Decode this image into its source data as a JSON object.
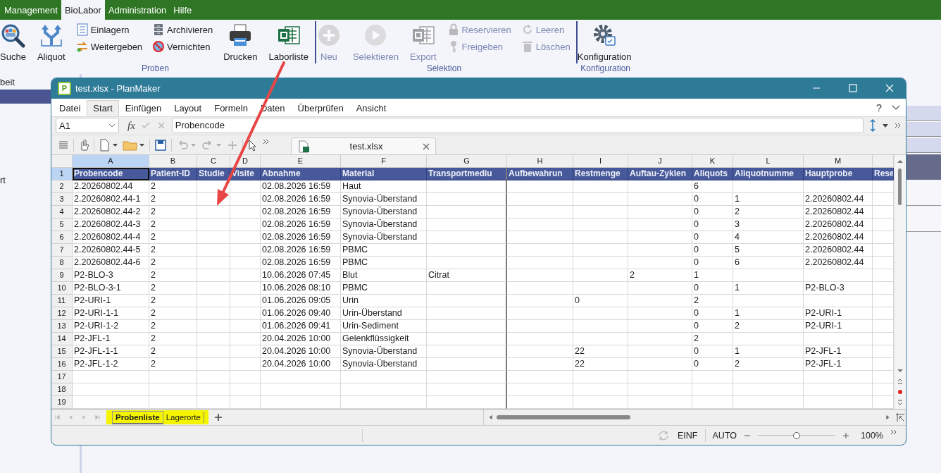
{
  "menu": [
    {
      "label": "Management",
      "selected": false
    },
    {
      "label": "BioLabor",
      "selected": true
    },
    {
      "label": "Administration",
      "selected": false
    },
    {
      "label": "Hilfe",
      "selected": false
    }
  ],
  "ribbon": {
    "groups": [
      {
        "label": "Proben",
        "items": [
          {
            "kind": "large",
            "label": "Suche",
            "disabled": false
          },
          {
            "kind": "large",
            "label": "Aliquot",
            "disabled": false
          },
          {
            "kind": "stack",
            "items": [
              {
                "label": "Einlagern",
                "disabled": false
              },
              {
                "label": "Weitergeben",
                "disabled": false
              }
            ]
          },
          {
            "kind": "stack",
            "items": [
              {
                "label": "Archivieren",
                "disabled": false
              },
              {
                "label": "Vernichten",
                "disabled": false
              }
            ]
          },
          {
            "kind": "large",
            "label": "Drucken",
            "disabled": false
          },
          {
            "kind": "large",
            "label": "Laborliste",
            "disabled": false
          }
        ]
      },
      {
        "label": "Selektion",
        "items": [
          {
            "kind": "large",
            "label": "Neu",
            "disabled": true
          },
          {
            "kind": "large",
            "label": "Selektieren",
            "disabled": true
          },
          {
            "kind": "large",
            "label": "Export",
            "disabled": true
          },
          {
            "kind": "stack",
            "items": [
              {
                "label": "Reservieren",
                "disabled": true
              },
              {
                "label": "Freigeben",
                "disabled": true
              }
            ]
          },
          {
            "kind": "stack",
            "items": [
              {
                "label": "Leeren",
                "disabled": true
              },
              {
                "label": "Löschen",
                "disabled": true
              }
            ]
          }
        ]
      },
      {
        "label": "Konfiguration",
        "items": [
          {
            "kind": "large",
            "label": "Konfiguration",
            "disabled": false
          }
        ]
      }
    ]
  },
  "sidebar": {
    "items": [
      {
        "label": "beit",
        "selected": false
      },
      {
        "selected": true
      },
      {
        "label": "rt",
        "selected": false
      }
    ]
  },
  "window": {
    "app_icon": "P",
    "title": "test.xlsx - PlanMaker",
    "menu": [
      {
        "label": "Datei",
        "selected": false
      },
      {
        "label": "Start",
        "selected": true
      },
      {
        "label": "Einfügen",
        "selected": false
      },
      {
        "label": "Layout",
        "selected": false
      },
      {
        "label": "Formeln",
        "selected": false
      },
      {
        "label": "Daten",
        "selected": false
      },
      {
        "label": "Überprüfen",
        "selected": false
      },
      {
        "label": "Ansicht",
        "selected": false
      }
    ],
    "help": "?",
    "cell_reference": "A1",
    "function_label": "fx",
    "formula": "Probencode",
    "document_tab": "test.xlsx"
  },
  "sheet": {
    "columns": [
      {
        "letter": "A",
        "selected": true
      },
      {
        "letter": "B",
        "selected": false
      },
      {
        "letter": "C",
        "selected": false
      },
      {
        "letter": "D",
        "selected": false
      },
      {
        "letter": "E",
        "selected": false
      },
      {
        "letter": "F",
        "selected": false
      },
      {
        "letter": "G",
        "selected": false
      },
      {
        "letter": "H",
        "selected": false
      },
      {
        "letter": "I",
        "selected": false
      },
      {
        "letter": "J",
        "selected": false
      },
      {
        "letter": "K",
        "selected": false
      },
      {
        "letter": "L",
        "selected": false
      },
      {
        "letter": "M",
        "selected": false
      }
    ],
    "rows": [
      {
        "number": "1",
        "selected": true,
        "kind": "header",
        "cells": [
          "Probencode",
          "Patient-ID",
          "Studie",
          "Visite",
          "Abnahme",
          "Material",
          "Transportmediu",
          "Aufbewahrun",
          "Restmenge",
          "Auftau-Zyklen",
          "Aliquots",
          "Aliquotnumme",
          "Hauptprobe",
          "Rese"
        ]
      },
      {
        "number": "2",
        "selected": false,
        "kind": "data",
        "cells": [
          "2.20260802.44",
          "2",
          null,
          null,
          "02.08.2026 16:59",
          "Haut",
          null,
          null,
          null,
          null,
          "6"
        ]
      },
      {
        "number": "3",
        "selected": false,
        "kind": "data",
        "cells": [
          "2.20260802.44-1",
          "2",
          null,
          null,
          "02.08.2026 16:59",
          "Synovia-Überstand",
          null,
          null,
          null,
          null,
          "0",
          "1",
          "2.20260802.44"
        ]
      },
      {
        "number": "4",
        "selected": false,
        "kind": "data",
        "cells": [
          "2.20260802.44-2",
          "2",
          null,
          null,
          "02.08.2026 16:59",
          "Synovia-Überstand",
          null,
          null,
          null,
          null,
          "0",
          "2",
          "2.20260802.44"
        ]
      },
      {
        "number": "5",
        "selected": false,
        "kind": "data",
        "cells": [
          "2.20260802.44-3",
          "2",
          null,
          null,
          "02.08.2026 16:59",
          "Synovia-Überstand",
          null,
          null,
          null,
          null,
          "0",
          "3",
          "2.20260802.44"
        ]
      },
      {
        "number": "6",
        "selected": false,
        "kind": "data",
        "cells": [
          "2.20260802.44-4",
          "2",
          null,
          null,
          "02.08.2026 16:59",
          "Synovia-Überstand",
          null,
          null,
          null,
          null,
          "0",
          "4",
          "2.20260802.44"
        ]
      },
      {
        "number": "7",
        "selected": false,
        "kind": "data",
        "cells": [
          "2.20260802.44-5",
          "2",
          null,
          null,
          "02.08.2026 16:59",
          "PBMC",
          null,
          null,
          null,
          null,
          "0",
          "5",
          "2.20260802.44"
        ]
      },
      {
        "number": "8",
        "selected": false,
        "kind": "data",
        "cells": [
          "2.20260802.44-6",
          "2",
          null,
          null,
          "02.08.2026 16:59",
          "PBMC",
          null,
          null,
          null,
          null,
          "0",
          "6",
          "2.20260802.44"
        ]
      },
      {
        "number": "9",
        "selected": false,
        "kind": "data",
        "cells": [
          "P2-BLO-3",
          "2",
          null,
          null,
          "10.06.2026 07:45",
          "Blut",
          "Citrat",
          null,
          null,
          "2",
          "1"
        ]
      },
      {
        "number": "10",
        "selected": false,
        "kind": "data",
        "cells": [
          "P2-BLO-3-1",
          "2",
          null,
          null,
          "10.06.2026 08:10",
          "PBMC",
          null,
          null,
          null,
          null,
          "0",
          "1",
          "P2-BLO-3"
        ]
      },
      {
        "number": "11",
        "selected": false,
        "kind": "data",
        "cells": [
          "P2-URI-1",
          "2",
          null,
          null,
          "01.06.2026 09:05",
          "Urin",
          null,
          null,
          "0",
          null,
          "2"
        ]
      },
      {
        "number": "12",
        "selected": false,
        "kind": "data",
        "cells": [
          "P2-URI-1-1",
          "2",
          null,
          null,
          "01.06.2026 09:40",
          "Urin-Überstand",
          null,
          null,
          null,
          null,
          "0",
          "1",
          "P2-URI-1"
        ]
      },
      {
        "number": "13",
        "selected": false,
        "kind": "data",
        "cells": [
          "P2-URI-1-2",
          "2",
          null,
          null,
          "01.06.2026 09:41",
          "Urin-Sediment",
          null,
          null,
          null,
          null,
          "0",
          "2",
          "P2-URI-1"
        ]
      },
      {
        "number": "14",
        "selected": false,
        "kind": "data",
        "cells": [
          "P2-JFL-1",
          "2",
          null,
          null,
          "20.04.2026 10:00",
          "Gelenkflüssigkeit",
          null,
          null,
          null,
          null,
          "2"
        ]
      },
      {
        "number": "15",
        "selected": false,
        "kind": "data",
        "cells": [
          "P2-JFL-1-1",
          "2",
          null,
          null,
          "20.04.2026 10:00",
          "Synovia-Überstand",
          null,
          null,
          "22",
          null,
          "0",
          "1",
          "P2-JFL-1"
        ]
      },
      {
        "number": "16",
        "selected": false,
        "kind": "data",
        "cells": [
          "P2-JFL-1-2",
          "2",
          null,
          null,
          "20.04.2026 10:00",
          "Synovia-Überstand",
          null,
          null,
          "22",
          null,
          "0",
          "2",
          "P2-JFL-1"
        ]
      },
      {
        "number": "17",
        "selected": false,
        "kind": "data",
        "cells": []
      },
      {
        "number": "18",
        "selected": false,
        "kind": "data",
        "cells": []
      },
      {
        "number": "19",
        "selected": false,
        "kind": "data",
        "cells": []
      }
    ]
  },
  "sheet_tabs": [
    {
      "label": "Probenliste",
      "selected": true
    },
    {
      "label": "Lagerorte",
      "selected": false
    }
  ],
  "status_bar": {
    "insert_mode": "EINF",
    "calc_mode": "AUTO",
    "zoom": {
      "level": 0.5,
      "reading": "100%"
    }
  }
}
